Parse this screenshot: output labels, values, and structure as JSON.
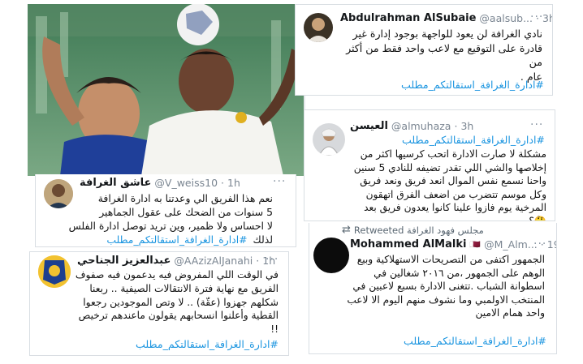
{
  "tweets": [
    {
      "name": "Abdulrahman AlSubaie",
      "handle": "@aalsub...",
      "time": "3h",
      "dot": "·",
      "lines": [
        "نادي الغرافة لن يعود للواجهة بوجود إدارة غير",
        "قادرة على التوقيع مع لاعب واحد فقط من أكثر من",
        "عام ."
      ],
      "hashtag": "#ادارة_الغرافة_استقالتكم_مطلب"
    },
    {
      "name": "العيسن",
      "handle": "@almuhaza",
      "time": "3h",
      "dot": "·",
      "hashtag_top": "#ادارة_الغرافة_استقالتكم_مطلب",
      "lines": [
        "مشكلة لا صارت الادارة اتحب كرسيها اكثر من",
        "إخلاصها والشي اللي تقدر تضيفه للنادي 5 سنين",
        "واحنا نسمع نفس الموال انعد فريق ونعد فريق",
        "وكل موسم تتضرب من اضعف الفرق اتهقون",
        "المرخية يوم فازوا علينا كانوا يعدون فريق بعد 🤔؟"
      ]
    },
    {
      "retweet_label": "مجلس فهود الغرافة Retweeted",
      "name": "Mohammed AlMalki",
      "flag": "🇶🇦",
      "handle": "@M_Alm...",
      "time": "19h",
      "dot": "·",
      "lines": [
        "الجمهور اكتفى من التصريحات الاستهلاكية وبيع",
        "الوهم على الجمهور ،من ٢٠١٦ شغالين في",
        "اسطوانة الشباب .تتغنى الادارة بسبع لاعبين في",
        "المنتخب الاولمبي وما نشوف منهم اليوم الا لاعب",
        "واحد همام الامين"
      ],
      "hashtag": "#ادارة_الغرافة_استقالتكم_مطلب"
    },
    {
      "name": "عاشق الغرافة",
      "handle": "@V_weiss10",
      "time": "1h",
      "dot": "·",
      "lines": [
        "نعم هذا الفريق الي وعدتنا به ادارة الغرافة",
        "5 سنوات من الضحك على عقول الجماهير",
        "لا احساس ولا ظمير، وين تريد توصل ادارة الفلس"
      ],
      "tag_prefix": "لذلك",
      "hashtag": "#ادارة_الغرافة_استقالتكم_مطلب"
    },
    {
      "name": "عبدالعزيز الجناحي",
      "handle": "@AAzizAlJanahi",
      "time": "1h",
      "dot": "·",
      "lines": [
        "في الوقت اللي المفروض فيه يدعمون فيه صفوف",
        "الفريق مع نهاية فترة الانتقالات الصيفية .. ربعنا",
        "شكلهم جهزوا (عقّة) .. لا وتص الموجودين رجعوا",
        "القطية وأعلنوا انسحابهم يقولون ماعندهم ترخيص",
        "!!"
      ],
      "hashtag": "#ادارة_الغرافة_استقالتكم_مطلب"
    }
  ],
  "more_glyph": "···"
}
